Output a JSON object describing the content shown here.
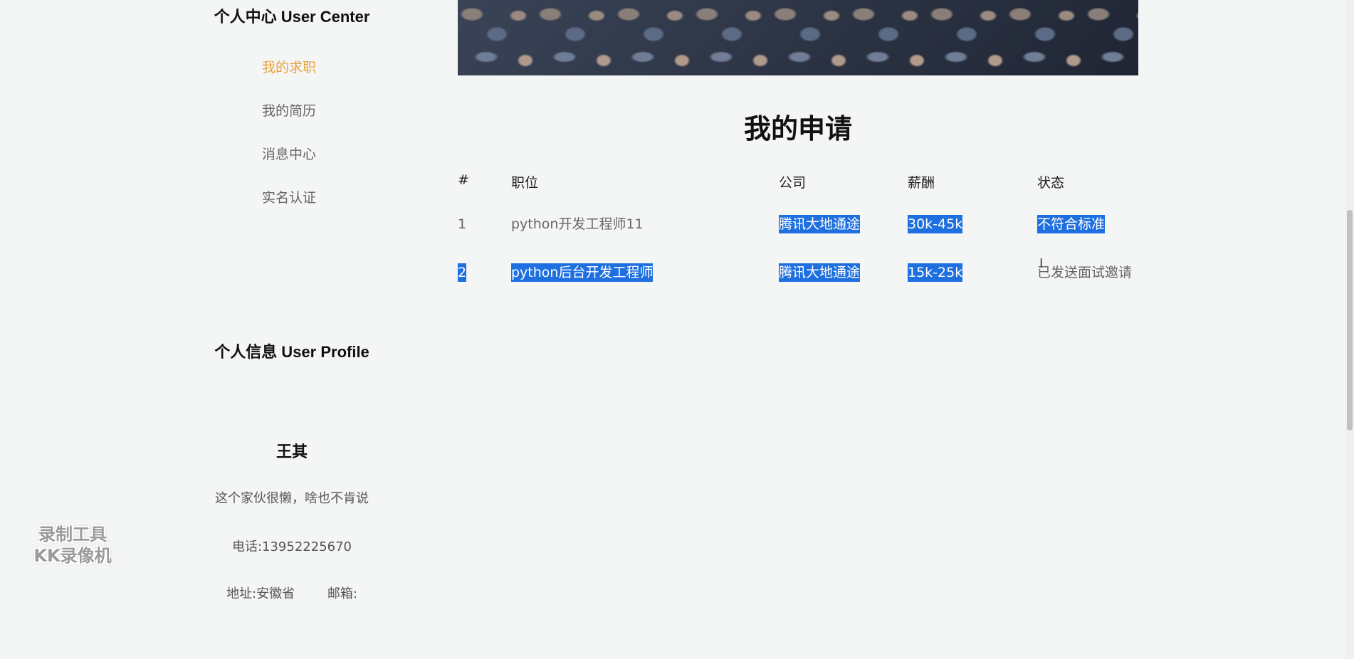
{
  "sidebar": {
    "center_title": "个人中心 User Center",
    "nav": [
      {
        "label": "我的求职",
        "active": true
      },
      {
        "label": "我的简历",
        "active": false
      },
      {
        "label": "消息中心",
        "active": false
      },
      {
        "label": "实名认证",
        "active": false
      }
    ],
    "profile_title": "个人信息 User Profile",
    "profile": {
      "name": "王其",
      "bio": "这个家伙很懒，啥也不肯说",
      "phone": "电话:13952225670",
      "address": "地址:安徽省",
      "email": "邮箱:"
    }
  },
  "main": {
    "title": "我的申请",
    "table": {
      "headers": [
        "#",
        "职位",
        "公司",
        "薪酬",
        "状态"
      ],
      "rows": [
        [
          "1",
          "python开发工程师11",
          "腾讯大地通途",
          "30k-45k",
          "不符合标准"
        ],
        [
          "2",
          "python后台开发工程师",
          "腾讯大地通途",
          "15k-25k",
          "已发送面试邀请"
        ]
      ]
    }
  },
  "watermark": {
    "line1": "录制工具",
    "line2": "KK录像机"
  },
  "colors": {
    "active_nav": "#e8a33d",
    "selection": "#1e6fe0",
    "background": "#f4f5f5"
  }
}
